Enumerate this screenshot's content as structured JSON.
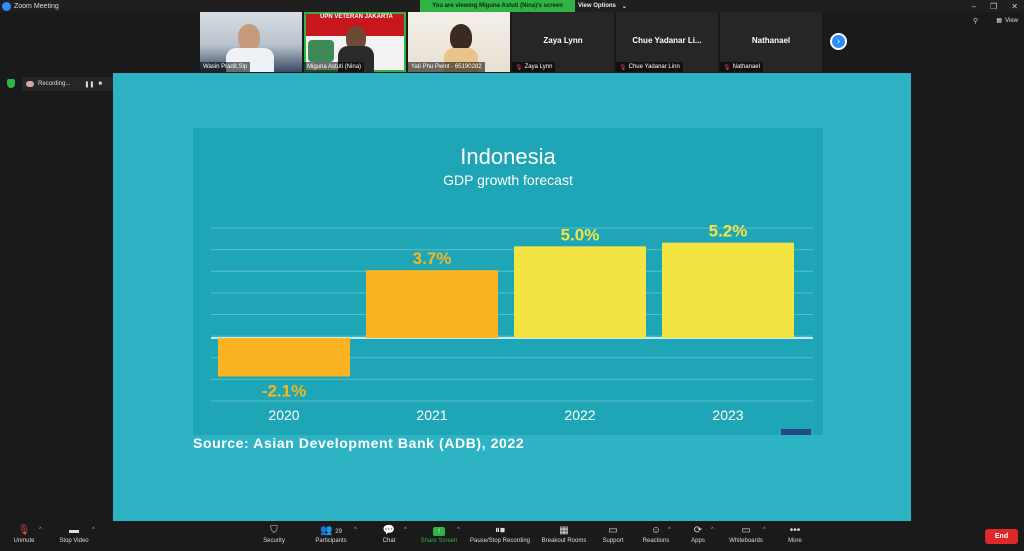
{
  "window": {
    "title": "Zoom Meeting"
  },
  "banner": {
    "text": "You are viewing Miguna Astuti (Nina)'s screen",
    "view_options": "View Options"
  },
  "view_button": "View",
  "participants_strip": [
    {
      "name": "Wasin Pradit.Slp",
      "has_video": true,
      "selected": false
    },
    {
      "name": "Miguna Astuti (Nina)",
      "has_video": true,
      "selected": true,
      "overlay_text": "UPN VETERAN JAKARTA"
    },
    {
      "name": "Yati Phu Pwint - 65190282",
      "has_video": true,
      "selected": false
    },
    {
      "name": "Zaya Lynn",
      "display_name": "Zaya Lynn",
      "has_video": false,
      "muted": true
    },
    {
      "name": "Chue Yadanar Linn",
      "display_name": "Chue Yadanar Li...",
      "has_video": false,
      "muted": true
    },
    {
      "name": "Nathanael",
      "display_name": "Nathanael",
      "has_video": false,
      "muted": true
    }
  ],
  "recording": {
    "label": "Recording..."
  },
  "slide": {
    "source": "Source: Asian Development Bank (ADB), 2022"
  },
  "chart_data": {
    "type": "bar",
    "title": "Indonesia",
    "subtitle": "GDP growth forecast",
    "categories": [
      "2020",
      "2021",
      "2022",
      "2023"
    ],
    "values": [
      -2.1,
      3.7,
      5.0,
      5.2
    ],
    "labels": [
      "-2.1%",
      "3.7%",
      "5.0%",
      "5.2%"
    ],
    "bar_colors": [
      "#fbb321",
      "#fbb321",
      "#f3e443",
      "#f3e443"
    ],
    "label_colors": [
      "#f6b81f",
      "#f6b81f",
      "#f3e443",
      "#f3e443"
    ],
    "ylim": [
      -3,
      6
    ],
    "grid": true,
    "xlabel": "",
    "ylabel": ""
  },
  "toolbar": {
    "unmute": "Unmute",
    "stop_video": "Stop Video",
    "security": "Security",
    "participants": "Participants",
    "participants_count": "29",
    "chat": "Chat",
    "share_screen": "Share Screen",
    "recording": "Pause/Stop Recording",
    "breakout_rooms": "Breakout Rooms",
    "support": "Support",
    "reactions": "Reactions",
    "apps": "Apps",
    "whiteboards": "Whiteboards",
    "more": "More",
    "end": "End"
  },
  "colors": {
    "share_bg": "#2db3c3",
    "slide_bg": "#1fa6b6",
    "accent_green": "#2fb344",
    "accent_blue": "#2d8cff",
    "end_red": "#e02828"
  }
}
